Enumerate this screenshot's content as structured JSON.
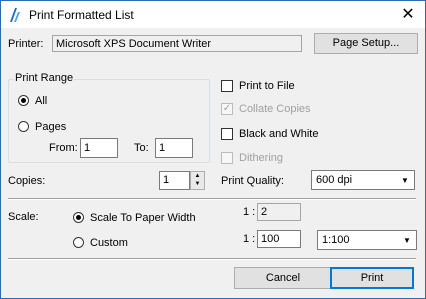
{
  "window": {
    "title": "Print Formatted List",
    "close_glyph": "✕"
  },
  "printer": {
    "label": "Printer:",
    "name": "Microsoft XPS Document Writer",
    "page_setup_label": "Page Setup..."
  },
  "print_range": {
    "group_title": "Print Range",
    "all_label": "All",
    "pages_label": "Pages",
    "selected": "All",
    "from_label": "From:",
    "from_value": "1",
    "to_label": "To:",
    "to_value": "1"
  },
  "options": {
    "print_to_file": {
      "label": "Print to File",
      "checked": false,
      "enabled": true
    },
    "collate_copies": {
      "label": "Collate Copies",
      "checked": true,
      "enabled": false,
      "mark": "✓"
    },
    "black_and_white": {
      "label": "Black and White",
      "checked": false,
      "enabled": true
    },
    "dithering": {
      "label": "Dithering",
      "checked": false,
      "enabled": false
    }
  },
  "copies": {
    "label": "Copies:",
    "value": "1",
    "up_glyph": "▲",
    "down_glyph": "▼"
  },
  "print_quality": {
    "label": "Print Quality:",
    "value": "600 dpi",
    "arrow_glyph": "▼"
  },
  "scale": {
    "label": "Scale:",
    "fit_label": "Scale To Paper Width",
    "custom_label": "Custom",
    "selected": "Scale To Paper Width",
    "ratio_prefix": "1 :",
    "fit_ratio": "2",
    "custom_prefix": "1 :",
    "custom_value": "100",
    "preset_value": "1:100",
    "arrow_glyph": "▼"
  },
  "buttons": {
    "cancel": "Cancel",
    "print": "Print"
  }
}
